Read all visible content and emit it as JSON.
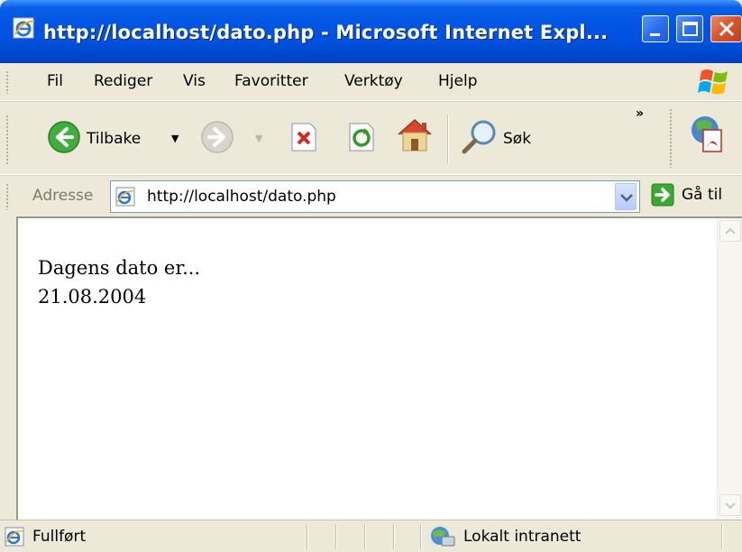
{
  "window": {
    "title": "http://localhost/dato.php - Microsoft Internet Expl..."
  },
  "menu": {
    "items": [
      {
        "label": "Fil"
      },
      {
        "label": "Rediger"
      },
      {
        "label": "Vis"
      },
      {
        "label": "Favoritter"
      },
      {
        "label": "Verktøy"
      },
      {
        "label": "Hjelp"
      }
    ]
  },
  "toolbar": {
    "back_label": "Tilbake",
    "search_label": "Søk",
    "more_label": "»"
  },
  "address": {
    "label": "Adresse",
    "url": "http://localhost/dato.php",
    "go_label": "Gå til"
  },
  "page": {
    "line1": "Dagens dato er...",
    "line2": "21.08.2004"
  },
  "status": {
    "text": "Fullført",
    "zone": "Lokalt intranett"
  },
  "colors": {
    "titlebar": "#0054e3",
    "chrome": "#ece9d8",
    "close": "#d8542c"
  }
}
